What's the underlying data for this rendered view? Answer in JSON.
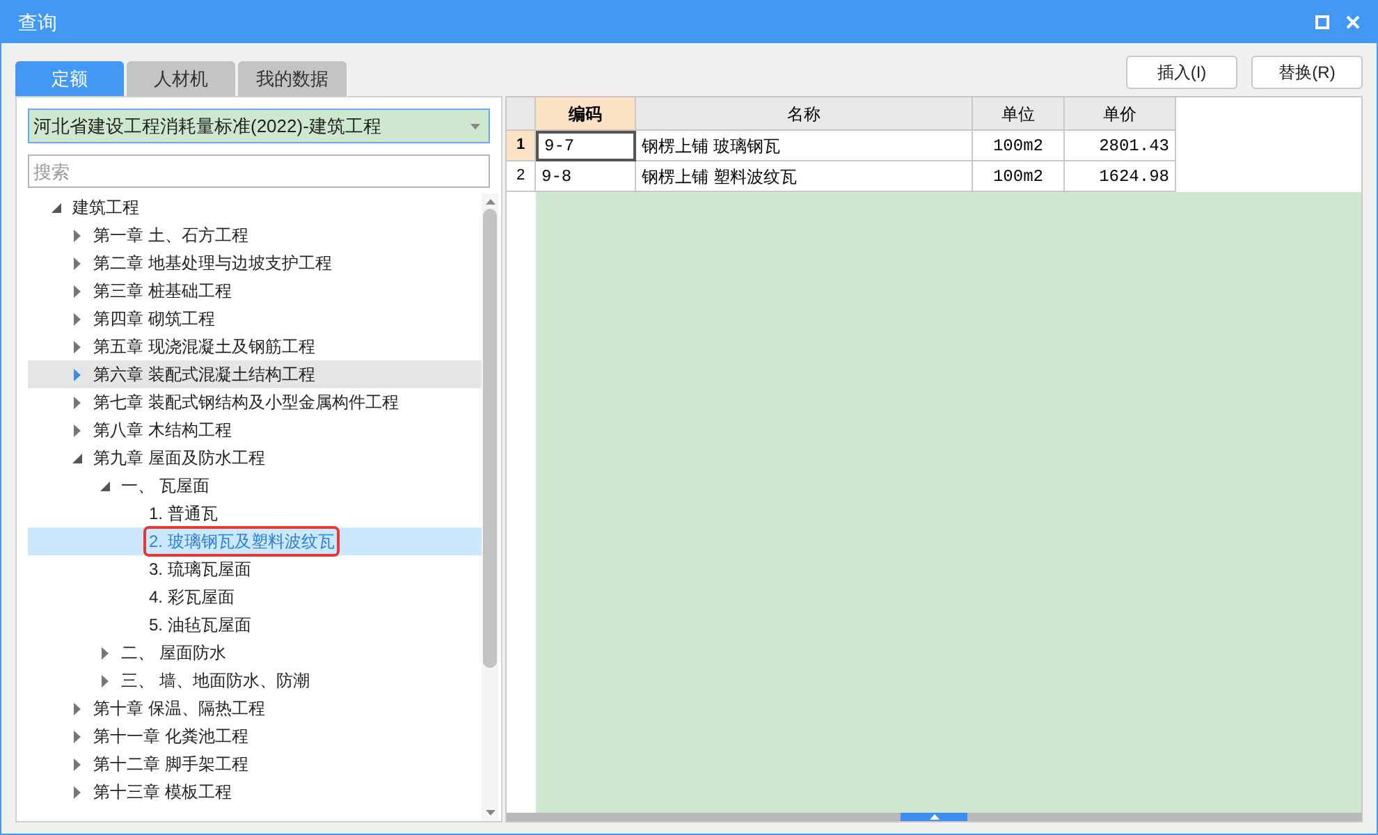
{
  "window": {
    "title": "查询"
  },
  "tabs": [
    {
      "label": "定额",
      "selected": true
    },
    {
      "label": "人材机",
      "selected": false
    },
    {
      "label": "我的数据",
      "selected": false
    }
  ],
  "library_select": {
    "value": "河北省建设工程消耗量标准(2022)-建筑工程"
  },
  "search": {
    "placeholder": "搜索"
  },
  "tree": [
    {
      "label": "建筑工程",
      "expanded": true,
      "selected": false,
      "hovered": false,
      "outlined": false,
      "children": [
        {
          "label": "第一章 土、石方工程",
          "expanded": false,
          "selected": false,
          "hovered": false,
          "outlined": false
        },
        {
          "label": "第二章 地基处理与边坡支护工程",
          "expanded": false,
          "selected": false,
          "hovered": false,
          "outlined": false
        },
        {
          "label": "第三章 桩基础工程",
          "expanded": false,
          "selected": false,
          "hovered": false,
          "outlined": false
        },
        {
          "label": "第四章 砌筑工程",
          "expanded": false,
          "selected": false,
          "hovered": false,
          "outlined": false
        },
        {
          "label": "第五章 现浇混凝土及钢筋工程",
          "expanded": false,
          "selected": false,
          "hovered": false,
          "outlined": false
        },
        {
          "label": "第六章 装配式混凝土结构工程",
          "expanded": false,
          "selected": false,
          "hovered": true,
          "outlined": false
        },
        {
          "label": "第七章 装配式钢结构及小型金属构件工程",
          "expanded": false,
          "selected": false,
          "hovered": false,
          "outlined": false
        },
        {
          "label": "第八章 木结构工程",
          "expanded": false,
          "selected": false,
          "hovered": false,
          "outlined": false
        },
        {
          "label": "第九章 屋面及防水工程",
          "expanded": true,
          "selected": false,
          "hovered": false,
          "outlined": false,
          "children": [
            {
              "label": "一、 瓦屋面",
              "expanded": true,
              "selected": false,
              "hovered": false,
              "outlined": false,
              "children": [
                {
                  "label": "1. 普通瓦",
                  "selected": false,
                  "hovered": false,
                  "outlined": false
                },
                {
                  "label": "2. 玻璃钢瓦及塑料波纹瓦",
                  "selected": true,
                  "hovered": false,
                  "outlined": true
                },
                {
                  "label": "3. 琉璃瓦屋面",
                  "selected": false,
                  "hovered": false,
                  "outlined": false
                },
                {
                  "label": "4. 彩瓦屋面",
                  "selected": false,
                  "hovered": false,
                  "outlined": false
                },
                {
                  "label": "5. 油毡瓦屋面",
                  "selected": false,
                  "hovered": false,
                  "outlined": false
                }
              ]
            },
            {
              "label": "二、 屋面防水",
              "expanded": false,
              "selected": false,
              "hovered": false,
              "outlined": false
            },
            {
              "label": "三、 墙、地面防水、防潮",
              "expanded": false,
              "selected": false,
              "hovered": false,
              "outlined": false
            }
          ]
        },
        {
          "label": "第十章 保温、隔热工程",
          "expanded": false,
          "selected": false,
          "hovered": false,
          "outlined": false
        },
        {
          "label": "第十一章 化粪池工程",
          "expanded": false,
          "selected": false,
          "hovered": false,
          "outlined": false
        },
        {
          "label": "第十二章 脚手架工程",
          "expanded": false,
          "selected": false,
          "hovered": false,
          "outlined": false
        },
        {
          "label": "第十三章 模板工程",
          "expanded": false,
          "selected": false,
          "hovered": false,
          "outlined": false
        }
      ]
    }
  ],
  "buttons": [
    "插入(I)",
    "替换(R)"
  ],
  "table": {
    "columns": [
      {
        "label": "编码",
        "selected": true
      },
      {
        "label": "名称",
        "selected": false
      },
      {
        "label": "单位",
        "selected": false
      },
      {
        "label": "单价",
        "selected": false
      }
    ],
    "rows": [
      {
        "number": "1",
        "selected": true,
        "cells": [
          "9-7",
          "钢楞上铺 玻璃钢瓦",
          "100m2",
          "2801.43"
        ]
      },
      {
        "number": "2",
        "selected": false,
        "cells": [
          "9-8",
          "钢楞上铺 塑料波纹瓦",
          "100m2",
          "1624.98"
        ]
      }
    ]
  }
}
